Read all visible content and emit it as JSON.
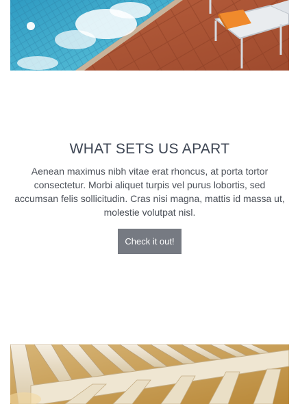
{
  "hero_image": {
    "subject": "pool-deck-with-lounger-photo",
    "colors": {
      "water": "#39a6c8",
      "tile": "#b25a3a",
      "lounger": "#e9ecef",
      "towel": "#f08a2c"
    }
  },
  "feature": {
    "title": "WHAT SETS US APART",
    "body": "Aenean maximus nibh vitae erat rhoncus, at porta tortor consectetur. Morbi aliquet turpis vel purus lobortis, sed accumsan felis sollicitudin. Cras nisi magna, mattis id massa ut, molestie volutpat nisl.",
    "button_label": "Check it out!",
    "colors": {
      "title": "#3d4553",
      "body": "#4a4f57",
      "button_bg": "#767a82",
      "button_text": "#ffffff"
    }
  },
  "footer_image": {
    "subject": "wooden-beam-ceiling-photo",
    "colors": {
      "beams": "#efe6d2",
      "wall": "#c99a4e"
    }
  }
}
